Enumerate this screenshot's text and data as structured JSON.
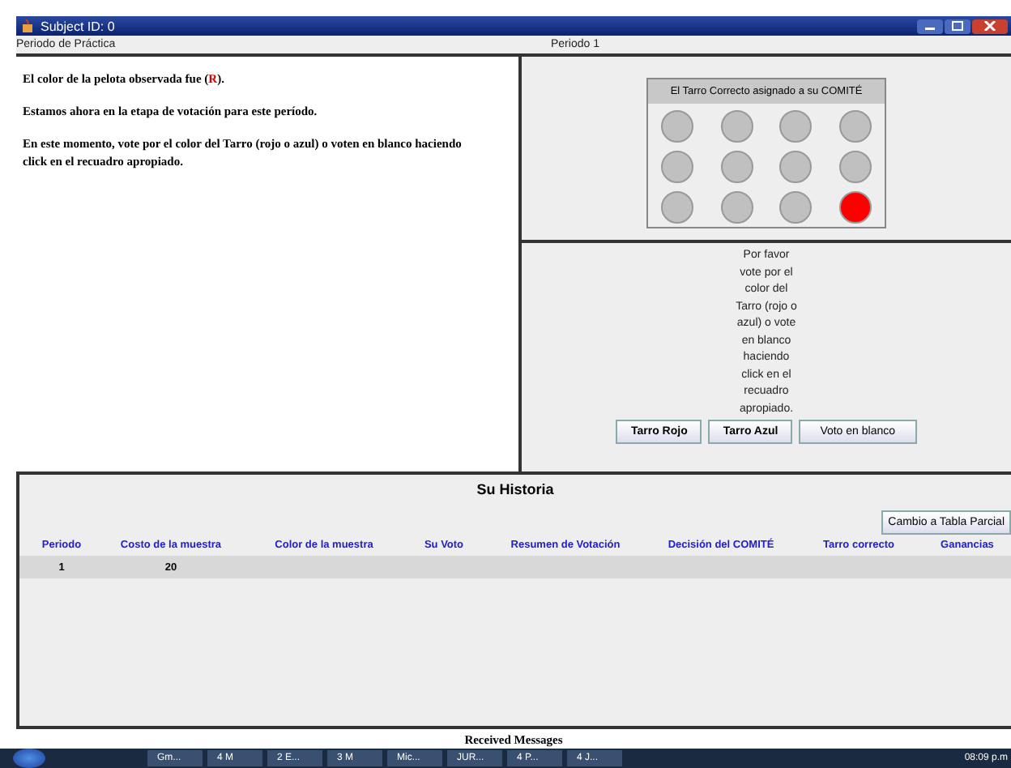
{
  "window": {
    "title": "Subject ID: 0"
  },
  "header": {
    "left": "Periodo de Práctica",
    "center": "Periodo 1"
  },
  "messages": [
    {
      "before": "El color de la pelota observada fue (",
      "highlight": "R",
      "after": ")."
    },
    {
      "before": "Estamos ahora en la etapa de votación para este período."
    },
    {
      "before": "En este momento, vote por el color del Tarro (rojo o azul) o voten en blanco haciendo click en el recuadro apropiado."
    }
  ],
  "jar_panel": {
    "title": "El Tarro Correcto asignado a su COMITÉ",
    "balls": [
      {
        "color": "#c0c0c0"
      },
      {
        "color": "#c0c0c0"
      },
      {
        "color": "#c0c0c0"
      },
      {
        "color": "#c0c0c0"
      },
      {
        "color": "#c0c0c0"
      },
      {
        "color": "#c0c0c0"
      },
      {
        "color": "#c0c0c0"
      },
      {
        "color": "#c0c0c0"
      },
      {
        "color": "#c0c0c0"
      },
      {
        "color": "#c0c0c0"
      },
      {
        "color": "#c0c0c0"
      },
      {
        "color": "#ff0000"
      }
    ]
  },
  "vote": {
    "prompt": "Por favor vote por el color del Tarro (rojo o azul) o vote en blanco haciendo click en el recuadro apropiado.",
    "buttons": [
      "Tarro Rojo",
      "Tarro Azul",
      "Voto en blanco"
    ]
  },
  "history": {
    "title": "Su Historia",
    "toggle_button": "Cambio a Tabla Parcial",
    "columns": [
      "Periodo",
      "Costo de la muestra",
      "Color de la muestra",
      "Su Voto",
      "Resumen de Votación",
      "Decisión del COMITÉ",
      "Tarro correcto",
      "Ganancias"
    ],
    "rows": [
      [
        "1",
        "20",
        "",
        "",
        "",
        "",
        "",
        ""
      ]
    ]
  },
  "received_messages": {
    "title": "Received Messages"
  },
  "taskbar": {
    "items": [
      "Gm...",
      "4 M",
      "2 E...",
      "3 M",
      "Mic...",
      "JUR...",
      "4 P...",
      "4 J..."
    ],
    "clock": "08:09 p.m"
  }
}
